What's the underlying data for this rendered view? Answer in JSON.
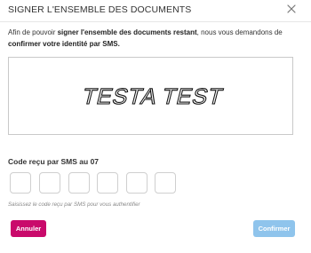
{
  "dialog": {
    "title": "SIGNER L'ENSEMBLE DES DOCUMENTS",
    "close_icon": "close-icon"
  },
  "intro": {
    "part1": "Afin de pouvoir ",
    "part2_bold": "signer l'ensemble des documents restant",
    "part3": ", nous vous demandons de ",
    "part4_bold": "confirmer votre identité par SMS."
  },
  "signature": {
    "text": "TESTA TEST"
  },
  "sms": {
    "label": "Code reçu par SMS au 07",
    "digit_count": 6,
    "digits": [
      "",
      "",
      "",
      "",
      "",
      ""
    ],
    "hint": "Saisissez le code reçu par SMS pour vous authentifier"
  },
  "actions": {
    "cancel_label": "Annuler",
    "confirm_label": "Confirmer",
    "cancel_color": "#c90a6b",
    "confirm_color": "#8fc4ec"
  }
}
